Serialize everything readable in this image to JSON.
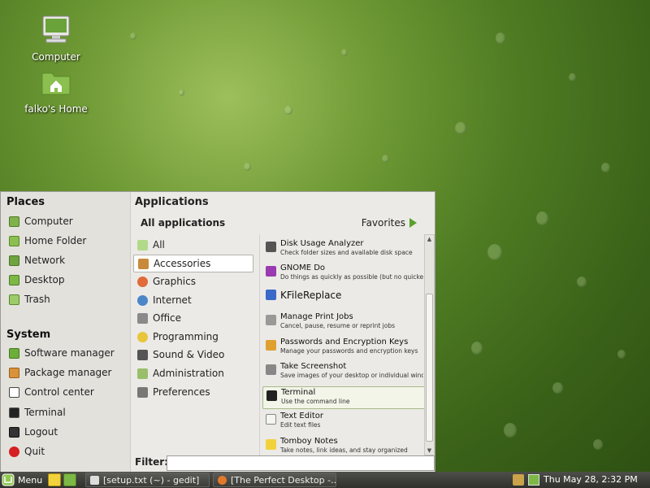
{
  "desktop": {
    "icons": [
      {
        "label": "Computer"
      },
      {
        "label": "falko's Home"
      }
    ]
  },
  "menu": {
    "places": {
      "heading": "Places",
      "items": [
        "Computer",
        "Home Folder",
        "Network",
        "Desktop",
        "Trash"
      ]
    },
    "system": {
      "heading": "System",
      "items": [
        "Software manager",
        "Package manager",
        "Control center",
        "Terminal",
        "Logout",
        "Quit"
      ]
    },
    "applications_heading": "Applications",
    "all_applications": "All applications",
    "favorites_label": "Favorites",
    "categories": [
      "All",
      "Accessories",
      "Graphics",
      "Internet",
      "Office",
      "Programming",
      "Sound & Video",
      "Administration",
      "Preferences"
    ],
    "selected_category": "Accessories",
    "apps": [
      {
        "title": "Disk Usage Analyzer",
        "desc": "Check folder sizes and available disk space"
      },
      {
        "title": "GNOME Do",
        "desc": "Do things as quickly as possible (but no quicker) wi..."
      },
      {
        "title": "KFileReplace",
        "desc": ""
      },
      {
        "title": "Manage Print Jobs",
        "desc": "Cancel, pause, resume or reprint jobs"
      },
      {
        "title": "Passwords and Encryption Keys",
        "desc": "Manage your passwords and encryption keys"
      },
      {
        "title": "Take Screenshot",
        "desc": "Save images of your desktop or individual windows"
      },
      {
        "title": "Terminal",
        "desc": "Use the command line"
      },
      {
        "title": "Text Editor",
        "desc": "Edit text files"
      },
      {
        "title": "Tomboy Notes",
        "desc": "Take notes, link ideas, and stay organized"
      }
    ],
    "selected_app": "Terminal",
    "filter_label": "Filter:",
    "filter_value": ""
  },
  "taskbar": {
    "menu_label": "Menu",
    "tasks": [
      "[setup.txt (~) - gedit]",
      "[The Perfect Desktop -..."
    ],
    "clock": "Thu May 28,  2:32 PM"
  },
  "colors": {
    "accent_green": "#5aa02c",
    "menu_bg": "#eceae6",
    "taskbar_bg": "#3a3a37"
  }
}
